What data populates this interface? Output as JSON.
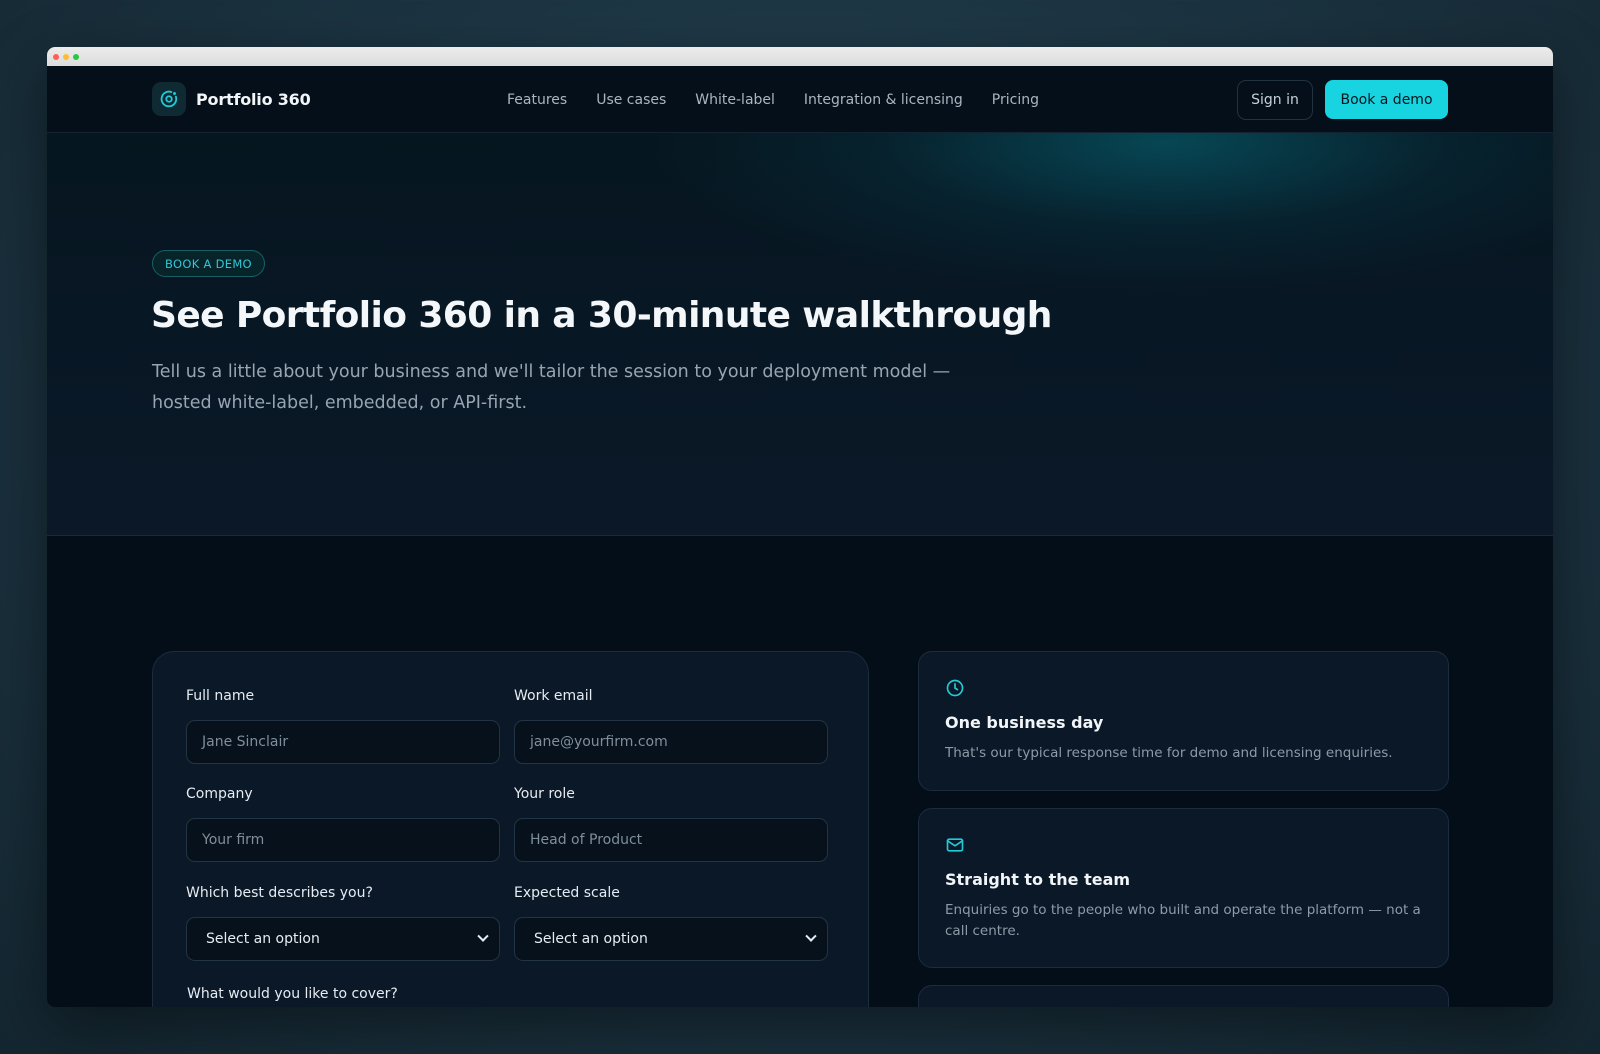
{
  "brand": {
    "name": "Portfolio 360",
    "logo_icon": "orbit-icon"
  },
  "nav": {
    "links": [
      "Features",
      "Use cases",
      "White-label",
      "Integration & licensing",
      "Pricing"
    ],
    "sign_in": "Sign in",
    "book_demo": "Book a demo"
  },
  "hero": {
    "eyebrow": "BOOK A DEMO",
    "title": "See Portfolio 360 in a 30-minute walkthrough",
    "subtitle": "Tell us a little about your business and we'll tailor the session to your deployment model — hosted white-label, embedded, or API-first."
  },
  "form": {
    "full_name": {
      "label": "Full name",
      "placeholder": "Jane Sinclair"
    },
    "work_email": {
      "label": "Work email",
      "placeholder": "jane@yourfirm.com"
    },
    "company": {
      "label": "Company",
      "placeholder": "Your firm"
    },
    "role": {
      "label": "Your role",
      "placeholder": "Head of Product"
    },
    "describes": {
      "label": "Which best describes you?",
      "selected": "Select an option"
    },
    "scale": {
      "label": "Expected scale",
      "selected": "Select an option"
    },
    "cover_label": "What would you like to cover?"
  },
  "info": [
    {
      "icon": "clock-icon",
      "title": "One business day",
      "text": "That's our typical response time for demo and licensing enquiries."
    },
    {
      "icon": "mail-icon",
      "title": "Straight to the team",
      "text": "Enquiries go to the people who built and operate the platform — not a call centre."
    }
  ],
  "colors": {
    "accent": "#18d3e0",
    "background": "#040e18",
    "card": "#0b1828"
  }
}
